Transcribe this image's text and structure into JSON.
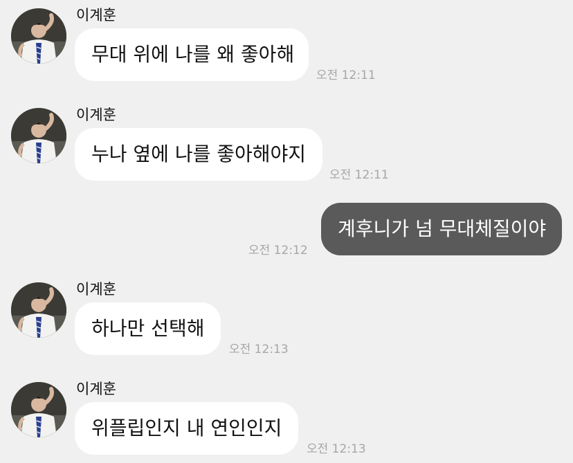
{
  "messages": [
    {
      "sender": "이계훈",
      "text": "무대 위에 나를 왜 좋아해",
      "time": "오전 12:11",
      "own": false
    },
    {
      "sender": "이계훈",
      "text": "누나 옆에 나를 좋아해야지",
      "time": "오전 12:11",
      "own": false
    },
    {
      "sender": "",
      "text": "계후니가 넘 무대체질이야",
      "time": "오전 12:12",
      "own": true
    },
    {
      "sender": "이계훈",
      "text": "하나만 선택해",
      "time": "오전 12:13",
      "own": false
    },
    {
      "sender": "이계훈",
      "text": "위플립인지 내 연인인지",
      "time": "오전 12:13",
      "own": false
    }
  ],
  "colors": {
    "background": "#f0f0f0",
    "incoming_bubble": "#ffffff",
    "outgoing_bubble": "#5a5a5a",
    "timestamp": "#a6a6a6"
  }
}
